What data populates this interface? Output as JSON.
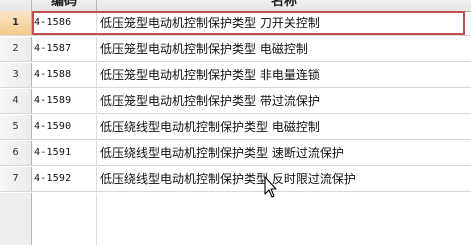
{
  "header": {
    "code_label": "编码",
    "name_label": "名称"
  },
  "rows": [
    {
      "num": "1",
      "code": "4-1586",
      "name": "低压笼型电动机控制保护类型  刀开关控制"
    },
    {
      "num": "2",
      "code": "4-1587",
      "name": "低压笼型电动机控制保护类型  电磁控制"
    },
    {
      "num": "3",
      "code": "4-1588",
      "name": "低压笼型电动机控制保护类型  非电量连锁"
    },
    {
      "num": "4",
      "code": "4-1589",
      "name": "低压笼型电动机控制保护类型  带过流保护"
    },
    {
      "num": "5",
      "code": "4-1590",
      "name": "低压绕线型电动机控制保护类型  电磁控制"
    },
    {
      "num": "6",
      "code": "4-1591",
      "name": "低压绕线型电动机控制保护类型  速断过流保护"
    },
    {
      "num": "7",
      "code": "4-1592",
      "name": "低压绕线型电动机控制保护类型  反时限过流保护"
    }
  ],
  "selected_row": "1",
  "icons": {
    "cursor": "mouse-pointer-icon"
  }
}
